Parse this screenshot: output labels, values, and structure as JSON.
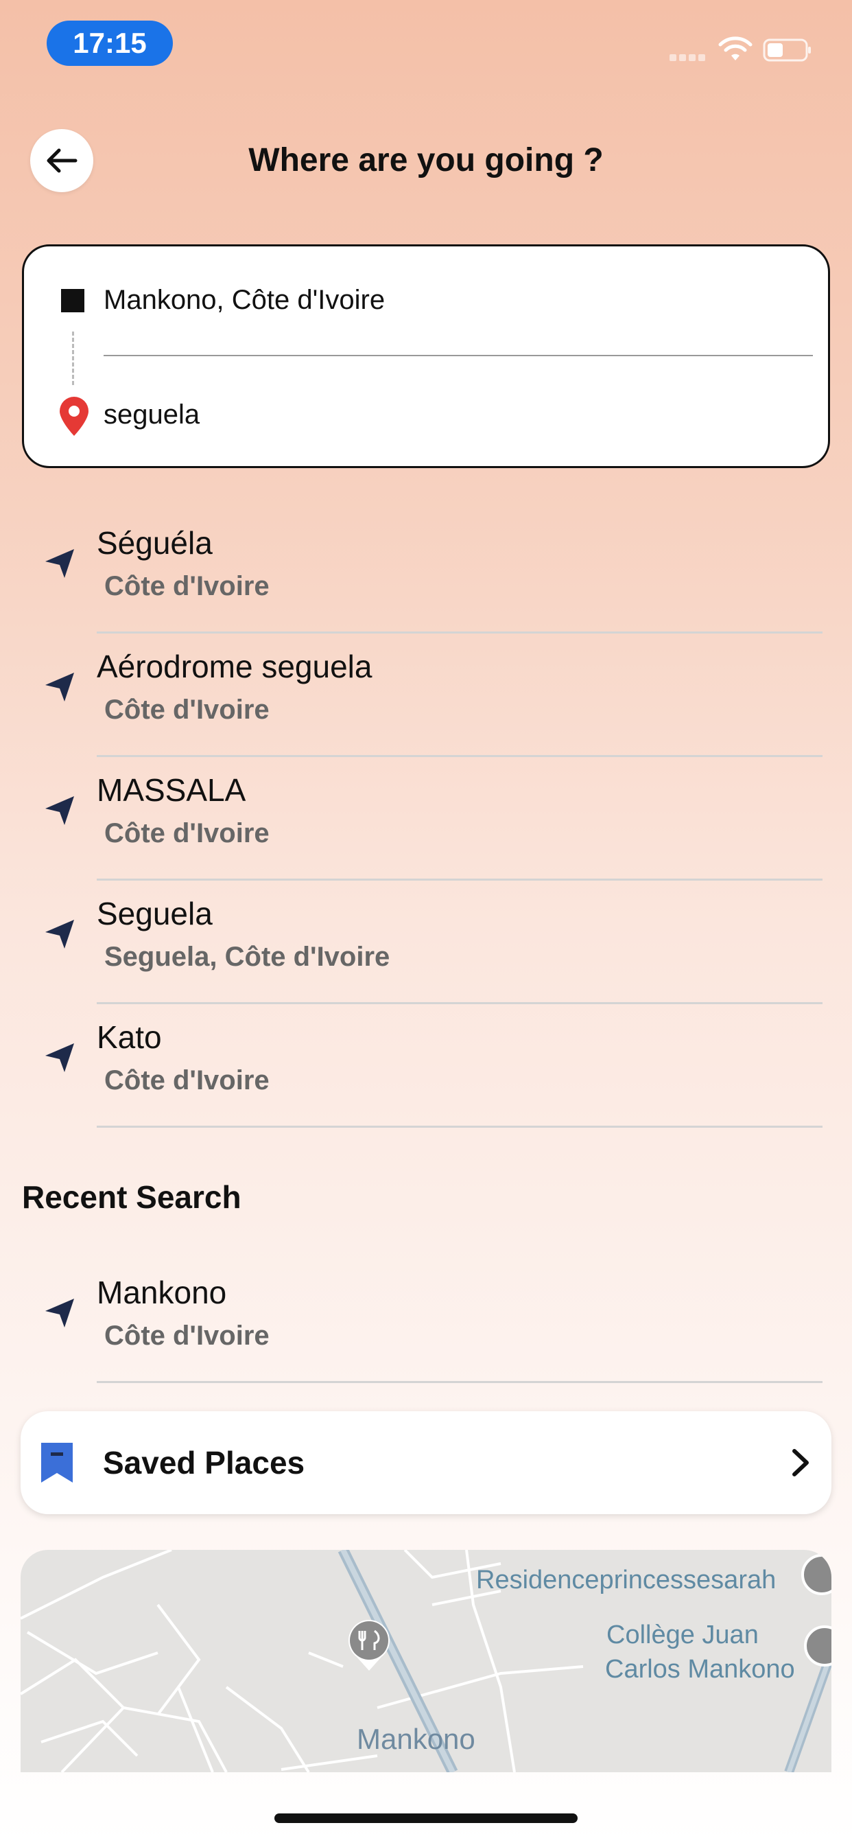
{
  "status_bar": {
    "time": "17:15",
    "icons": [
      "signal-icon",
      "wifi-icon",
      "battery-icon"
    ]
  },
  "header": {
    "title": "Where are you going ?",
    "back_icon": "arrow-left-icon"
  },
  "route": {
    "origin": "Mankono, Côte d'Ivoire",
    "destination_value": "seguela",
    "destination_placeholder": ""
  },
  "results": [
    {
      "title": "Séguéla",
      "subtitle": "Côte d'Ivoire"
    },
    {
      "title": "Aérodrome seguela",
      "subtitle": "Côte d'Ivoire"
    },
    {
      "title": "MASSALA",
      "subtitle": "Côte d'Ivoire"
    },
    {
      "title": "Seguela",
      "subtitle": "Seguela, Côte d'Ivoire"
    },
    {
      "title": "Kato",
      "subtitle": "Côte d'Ivoire"
    }
  ],
  "recent": {
    "title": "Recent Search",
    "items": [
      {
        "title": "Mankono",
        "subtitle": "Côte d'Ivoire"
      }
    ]
  },
  "saved_places": {
    "label": "Saved Places"
  },
  "map": {
    "labels": [
      "Residenceprincessesarah",
      "Collège Juan",
      "Carlos Mankono"
    ],
    "town": "Mankono"
  },
  "colors": {
    "accent_blue": "#1a73e8",
    "nav_icon": "#1e2a4a",
    "pin_red": "#e53935",
    "bookmark_blue": "#3b6fd8"
  }
}
